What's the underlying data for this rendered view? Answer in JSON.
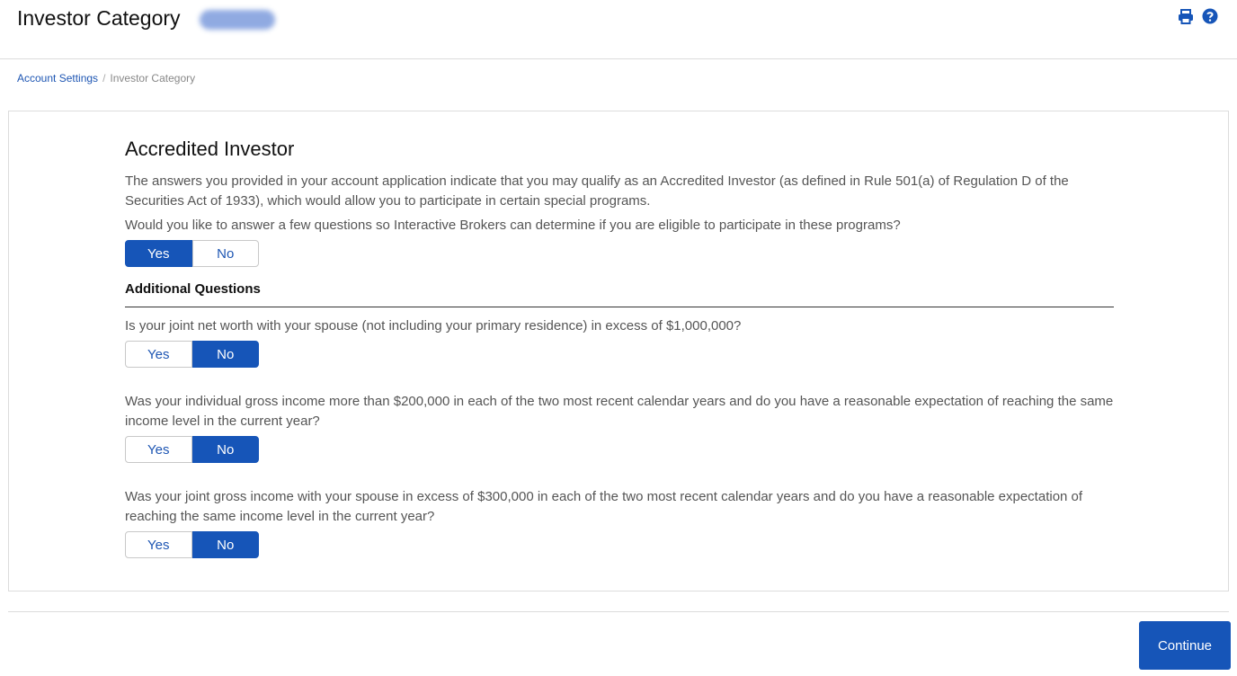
{
  "header": {
    "title": "Investor Category",
    "icons": [
      "print-icon",
      "help-icon"
    ]
  },
  "breadcrumb": {
    "link": "Account Settings",
    "separator": "/",
    "current": "Investor Category"
  },
  "main": {
    "title": "Accredited Investor",
    "intro": "The answers you provided in your account application indicate that you may qualify as an Accredited Investor (as defined in Rule 501(a) of Regulation D of the Securities Act of 1933), which would allow you to participate in certain special programs.",
    "question": "Would you like to answer a few questions so Interactive Brokers can determine if you are eligible to participate in these programs?",
    "toggle": {
      "yes": "Yes",
      "no": "No",
      "selected": "Yes"
    },
    "additional_heading": "Additional Questions",
    "questions": [
      {
        "text": "Is your joint net worth with your spouse (not including your primary residence) in excess of $1,000,000?",
        "yes": "Yes",
        "no": "No",
        "selected": "No"
      },
      {
        "text": "Was your individual gross income more than $200,000 in each of the two most recent calendar years and do you have a reasonable expectation of reaching the same income level in the current year?",
        "yes": "Yes",
        "no": "No",
        "selected": "No"
      },
      {
        "text": "Was your joint gross income with your spouse in excess of $300,000 in each of the two most recent calendar years and do you have a reasonable expectation of reaching the same income level in the current year?",
        "yes": "Yes",
        "no": "No",
        "selected": "No"
      }
    ]
  },
  "footer": {
    "continue_label": "Continue"
  },
  "colors": {
    "accent": "#1655b8",
    "link": "#1e56b3",
    "text": "#555555"
  }
}
